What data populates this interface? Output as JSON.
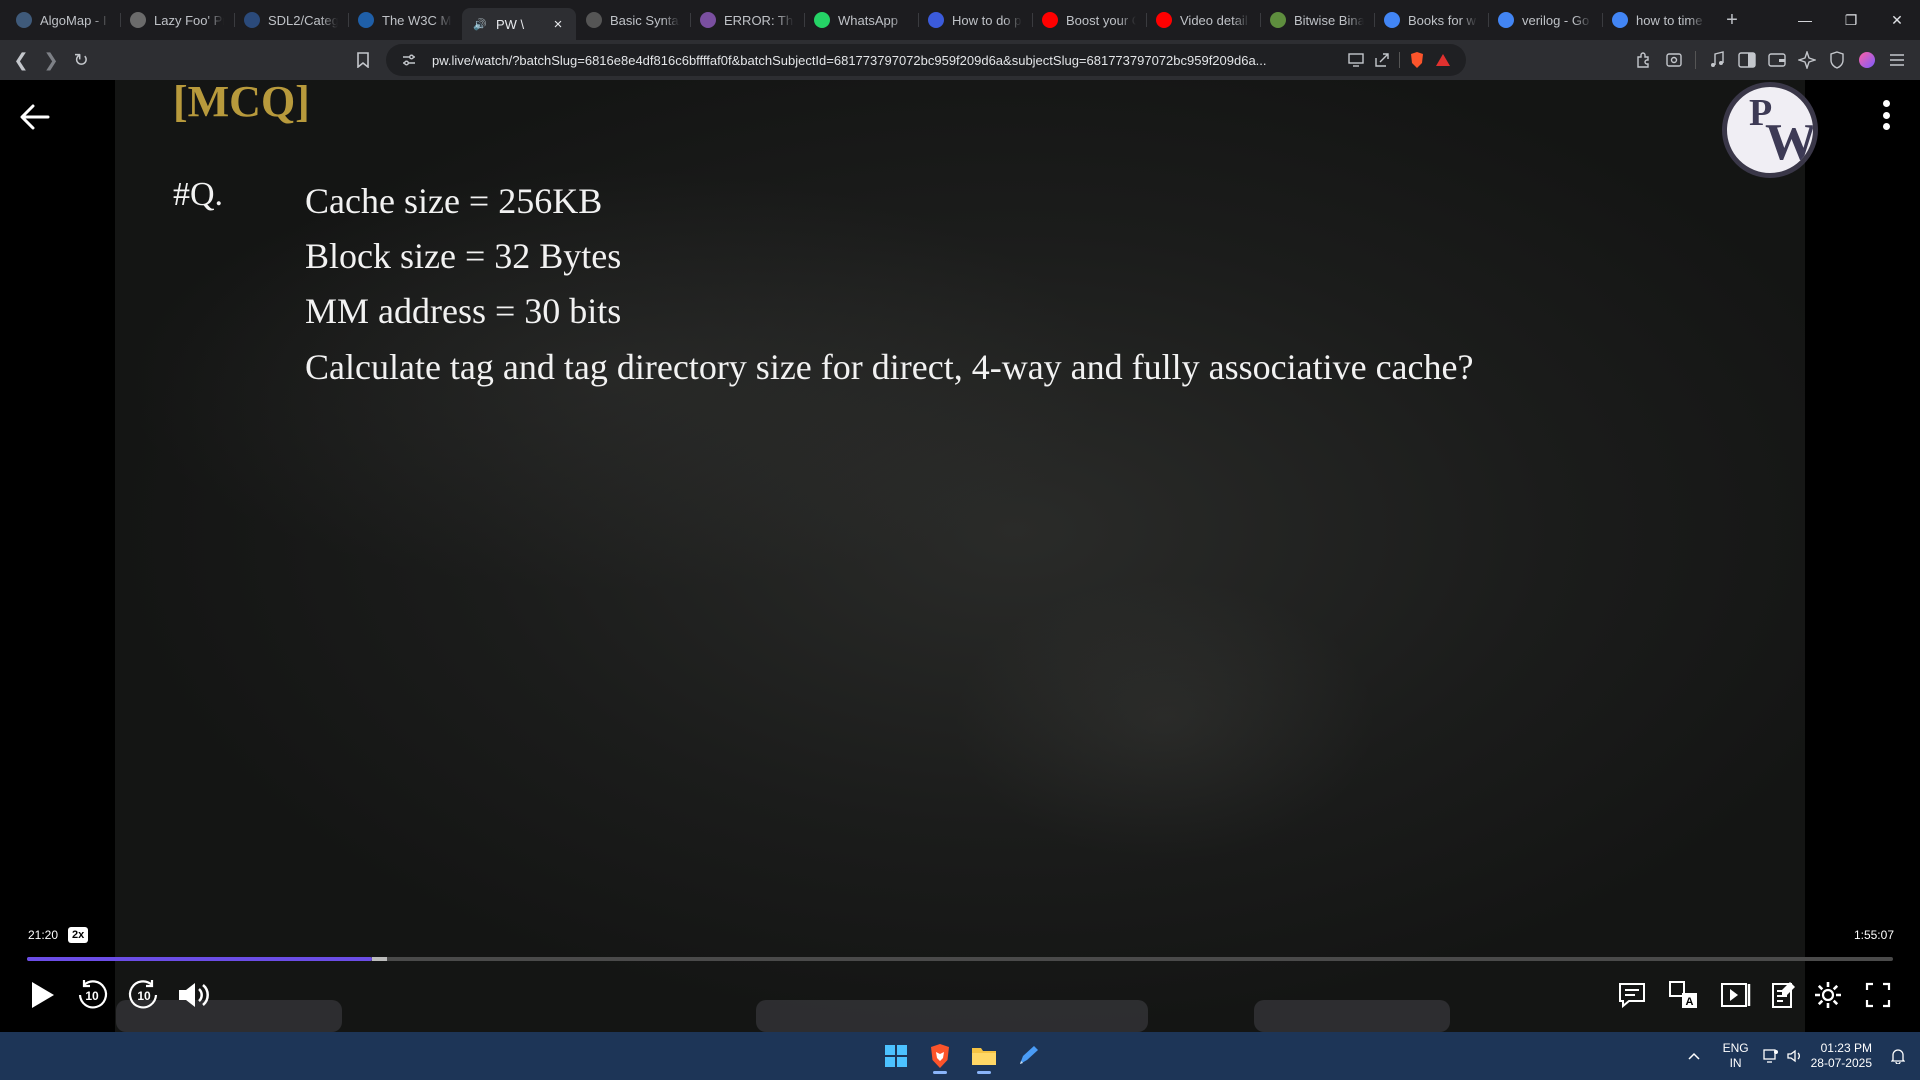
{
  "browser": {
    "tabs": [
      {
        "title": "AlgoMap - I",
        "icon": "algomap-icon",
        "color": "#3f5a7a"
      },
      {
        "title": "Lazy Foo' Pr",
        "icon": "lazyfoo-icon",
        "color": "#6b6b6b"
      },
      {
        "title": "SDL2/Categ",
        "icon": "sdl-icon",
        "color": "#2b4a7a"
      },
      {
        "title": "The W3C M",
        "icon": "w3c-icon",
        "color": "#1f5fa8"
      },
      {
        "title": "PW \\",
        "icon": "audio-playing-icon",
        "color": "#444444",
        "active": true
      },
      {
        "title": "Basic Syntax",
        "icon": "doc-icon",
        "color": "#555555"
      },
      {
        "title": "ERROR: The",
        "icon": "error-icon",
        "color": "#7a4fa0"
      },
      {
        "title": "WhatsApp",
        "icon": "whatsapp-icon",
        "color": "#25d366"
      },
      {
        "title": "How to do p",
        "icon": "bookmark-icon",
        "color": "#3b5bdb"
      },
      {
        "title": "Boost your C",
        "icon": "youtube-icon",
        "color": "#ff0000"
      },
      {
        "title": "Video detail",
        "icon": "youtube-icon",
        "color": "#ff0000"
      },
      {
        "title": "Bitwise Bina",
        "icon": "gfg-icon",
        "color": "#5e8e3e"
      },
      {
        "title": "Books for w",
        "icon": "google-icon",
        "color": "#4285f4"
      },
      {
        "title": "verilog - Go",
        "icon": "google-icon",
        "color": "#4285f4"
      },
      {
        "title": "how to time",
        "icon": "google-icon",
        "color": "#4285f4"
      }
    ],
    "url": "pw.live/watch/?batchSlug=6816e8e4df816c6bffffaf0f&batchSubjectId=681773797072bc959f209d6a&subjectSlug=681773797072bc959f209d6a..."
  },
  "video": {
    "tag": "[MCQ]",
    "question_label": "#Q.",
    "lines": [
      "Cache size = 256KB",
      "Block size = 32 Bytes",
      "MM address = 30 bits",
      "Calculate tag and tag directory size for direct, 4-way and fully associative cache?"
    ],
    "logo_letters": [
      "P",
      "W"
    ]
  },
  "player": {
    "current_time": "21:20",
    "speed": "2x",
    "total_time": "1:55:07",
    "played_fraction": 0.185,
    "buffered_fraction": 0.193,
    "rewind_label": "10",
    "forward_label": "10",
    "accent_color": "#6b4de6"
  },
  "taskbar": {
    "language": "ENG",
    "region": "IN",
    "time": "01:23 PM",
    "date": "28-07-2025"
  }
}
